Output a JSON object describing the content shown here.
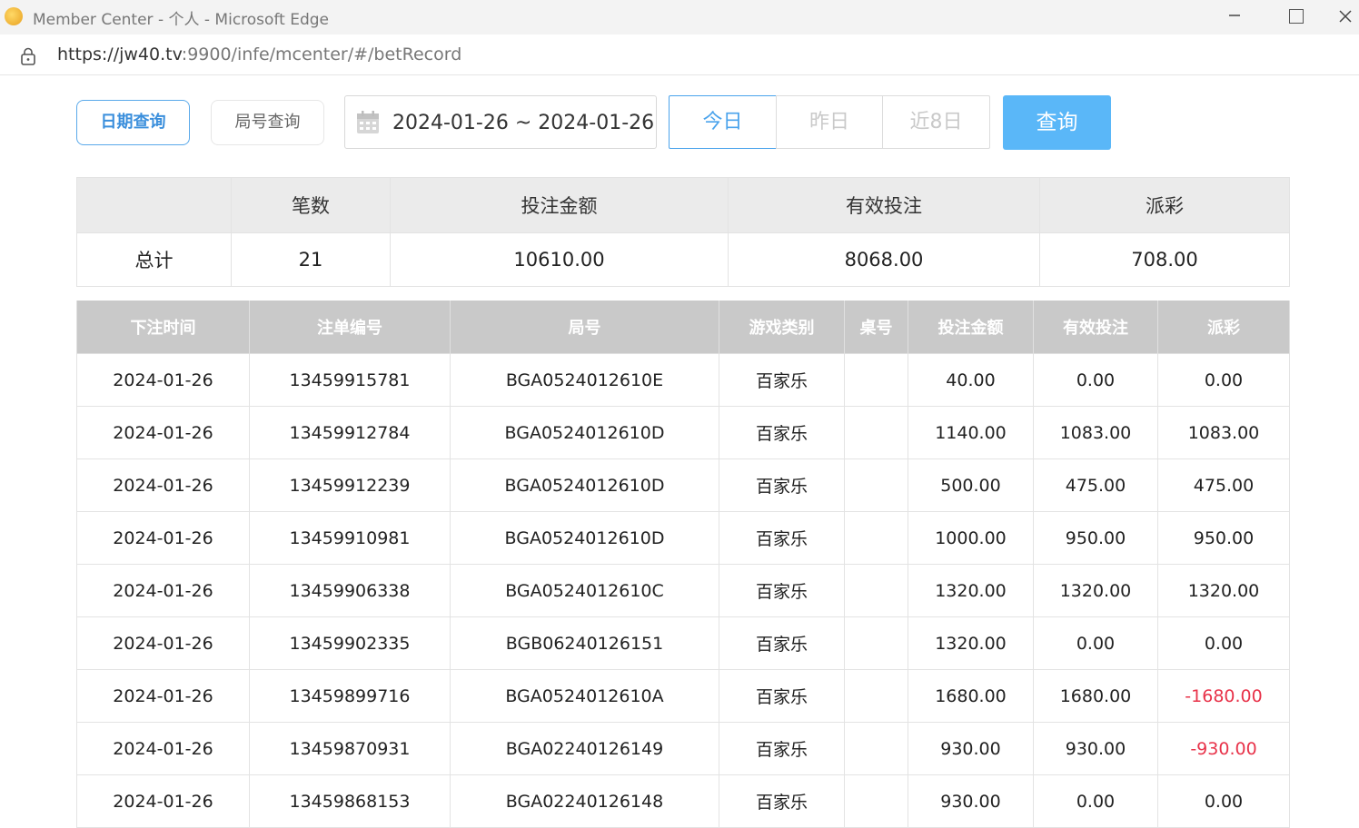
{
  "window": {
    "title": "Member Center - 个人 - Microsoft Edge",
    "minimize": "—",
    "close": ""
  },
  "address": {
    "url_main": "https://jw40.tv",
    "url_rest": ":9900/infe/mcenter/#/betRecord"
  },
  "filters": {
    "date_query": "日期查询",
    "round_query": "局号查询",
    "date_range": "2024-01-26 ~ 2024-01-26",
    "today": "今日",
    "yesterday": "昨日",
    "last8": "近8日",
    "search": "查询"
  },
  "summary": {
    "headers": [
      "",
      "笔数",
      "投注金额",
      "有效投注",
      "派彩"
    ],
    "row": [
      "总计",
      "21",
      "10610.00",
      "8068.00",
      "708.00"
    ]
  },
  "records": {
    "headers": [
      "下注时间",
      "注单编号",
      "局号",
      "游戏类别",
      "桌号",
      "投注金额",
      "有效投注",
      "派彩"
    ],
    "rows": [
      [
        "2024-01-26",
        "13459915781",
        "BGA0524012610E",
        "百家乐",
        "",
        "40.00",
        "0.00",
        "0.00"
      ],
      [
        "2024-01-26",
        "13459912784",
        "BGA0524012610D",
        "百家乐",
        "",
        "1140.00",
        "1083.00",
        "1083.00"
      ],
      [
        "2024-01-26",
        "13459912239",
        "BGA0524012610D",
        "百家乐",
        "",
        "500.00",
        "475.00",
        "475.00"
      ],
      [
        "2024-01-26",
        "13459910981",
        "BGA0524012610D",
        "百家乐",
        "",
        "1000.00",
        "950.00",
        "950.00"
      ],
      [
        "2024-01-26",
        "13459906338",
        "BGA0524012610C",
        "百家乐",
        "",
        "1320.00",
        "1320.00",
        "1320.00"
      ],
      [
        "2024-01-26",
        "13459902335",
        "BGB06240126151",
        "百家乐",
        "",
        "1320.00",
        "0.00",
        "0.00"
      ],
      [
        "2024-01-26",
        "13459899716",
        "BGA0524012610A",
        "百家乐",
        "",
        "1680.00",
        "1680.00",
        "-1680.00"
      ],
      [
        "2024-01-26",
        "13459870931",
        "BGA02240126149",
        "百家乐",
        "",
        "930.00",
        "930.00",
        "-930.00"
      ],
      [
        "2024-01-26",
        "13459868153",
        "BGA02240126148",
        "百家乐",
        "",
        "930.00",
        "0.00",
        "0.00"
      ]
    ]
  },
  "colors": {
    "accent": "#4aa3ec",
    "search_bg": "#5ab7f8",
    "negative": "#e8334a",
    "table_header_bg": "#c9c9c9"
  }
}
